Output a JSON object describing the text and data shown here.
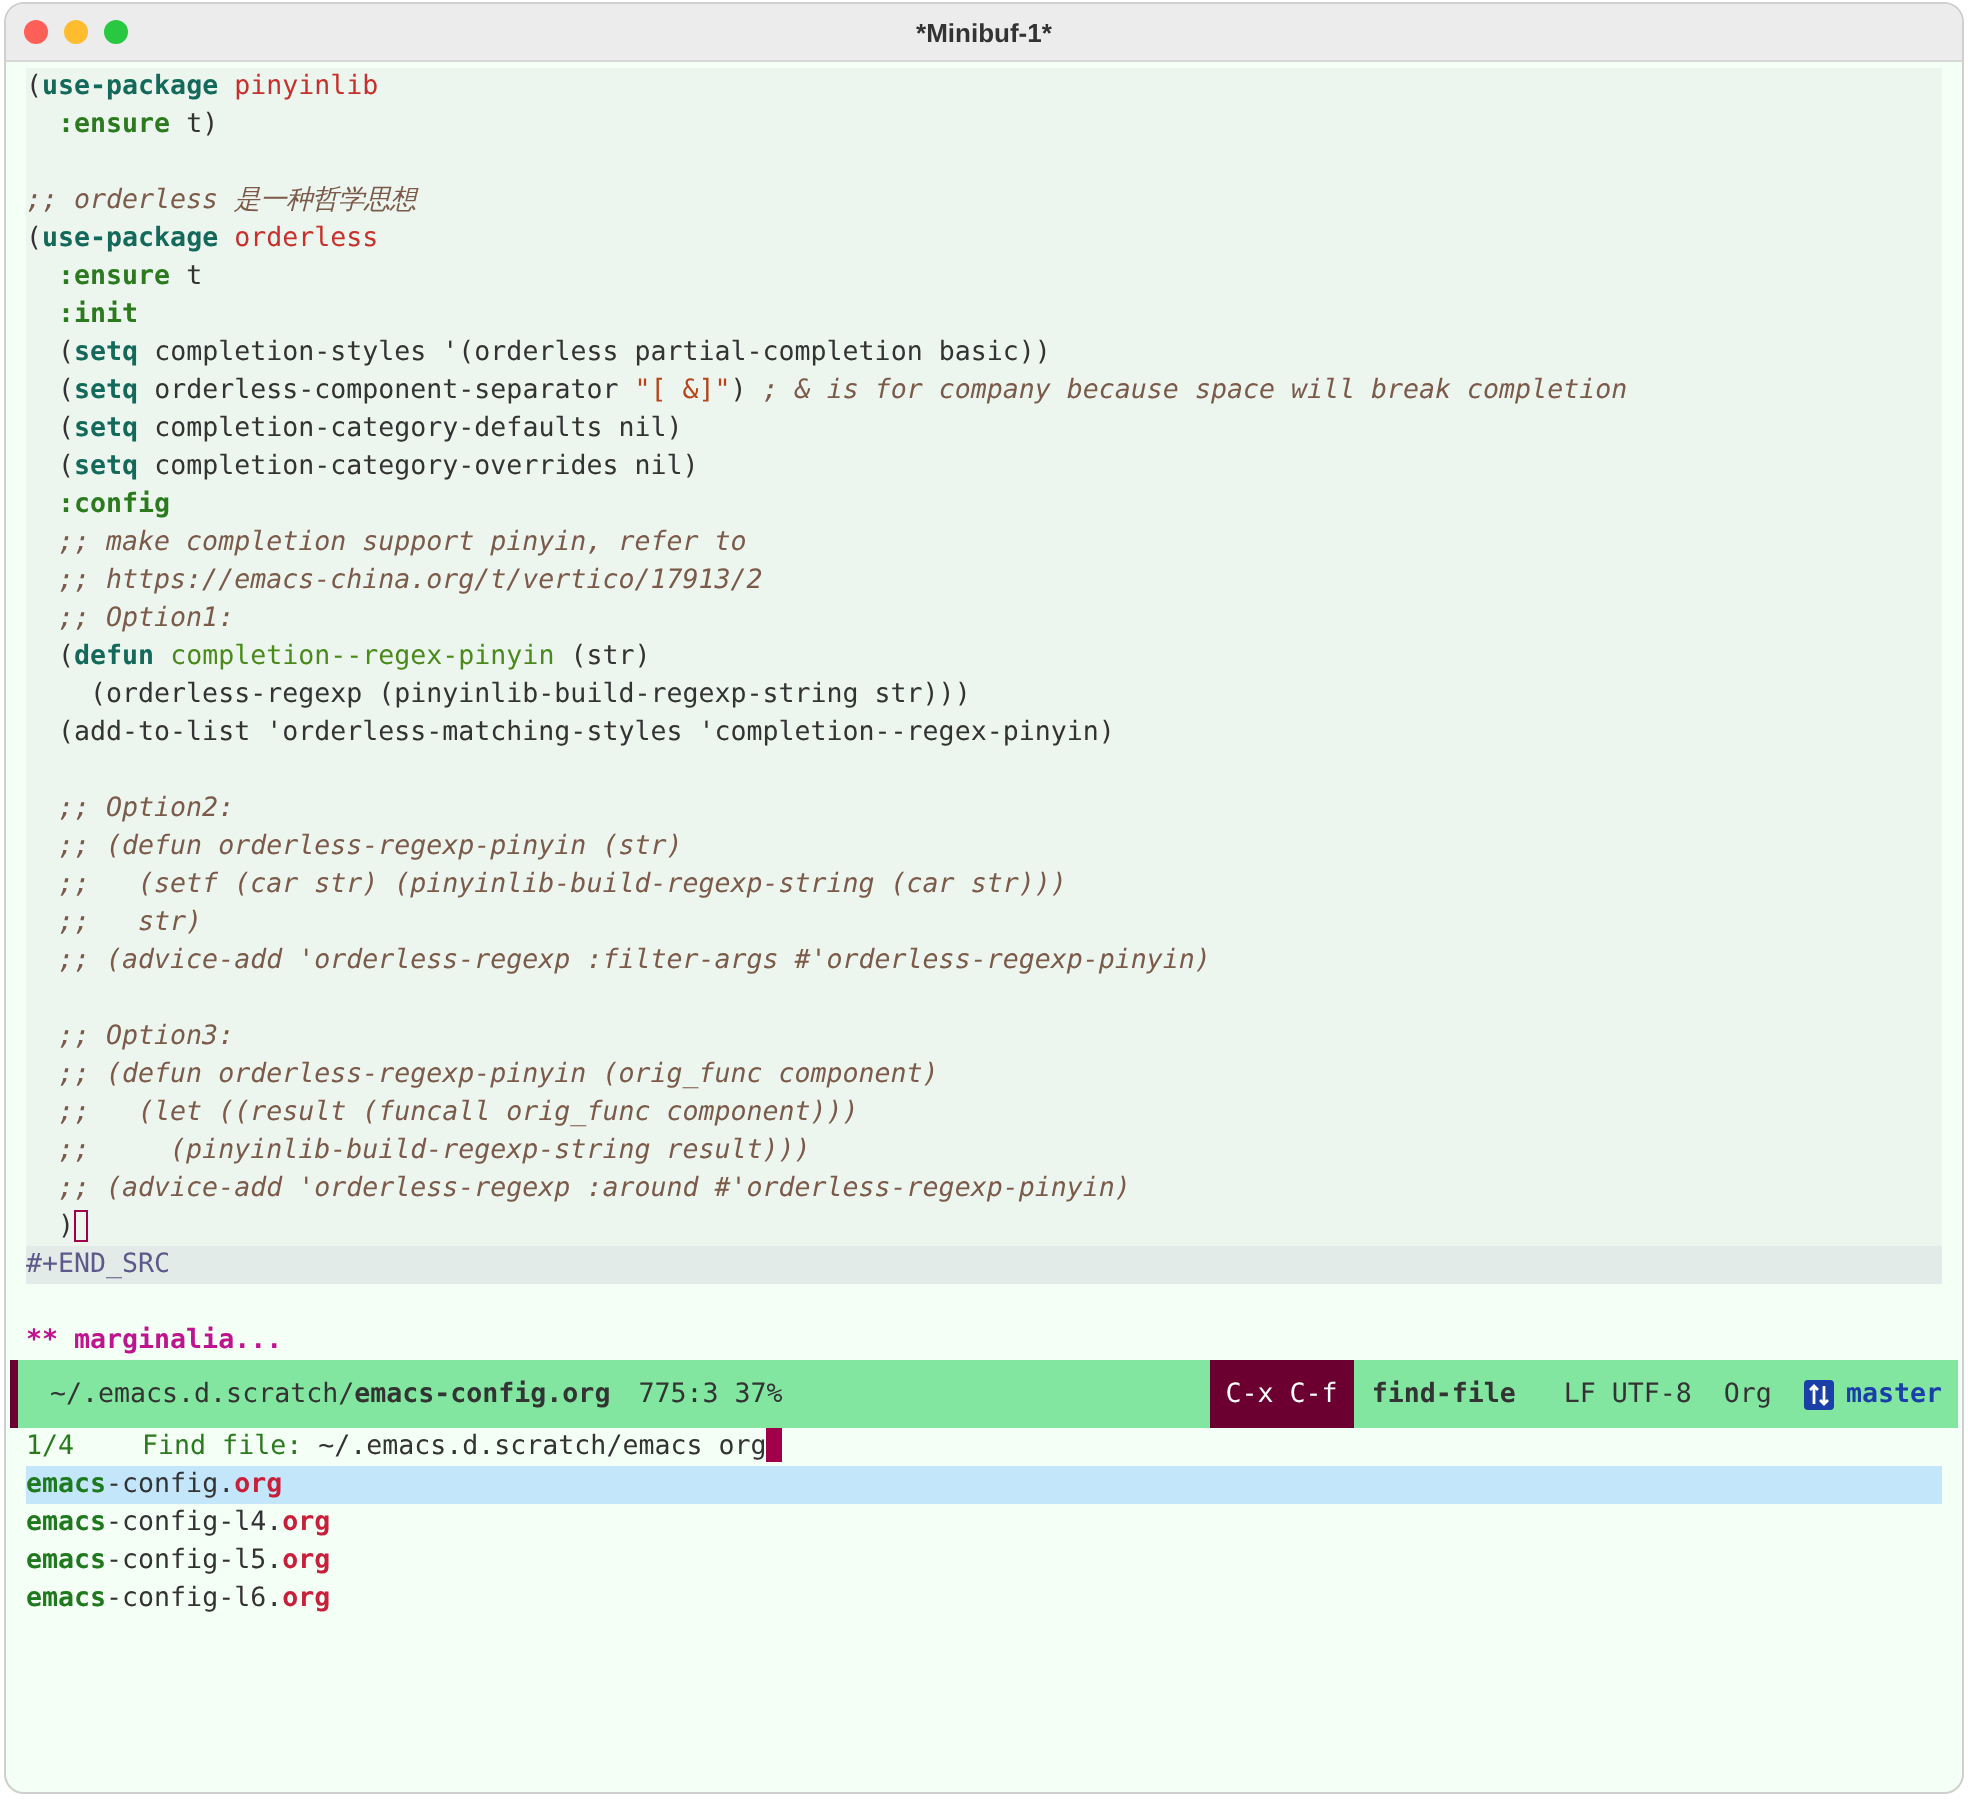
{
  "window": {
    "title": "*Minibuf-1*"
  },
  "code": {
    "lines": [
      {
        "kind": "code",
        "segments": [
          {
            "kind": "plain",
            "text": "("
          },
          {
            "kind": "kw",
            "text": "use-package"
          },
          {
            "kind": "pkg",
            "text": " pinyinlib"
          }
        ]
      },
      {
        "kind": "code",
        "segments": [
          {
            "kind": "prop",
            "text": "  :ensure"
          },
          {
            "kind": "plain",
            "text": " t)"
          }
        ]
      },
      {
        "kind": "blank"
      },
      {
        "kind": "code",
        "segments": [
          {
            "kind": "comment",
            "text": ";; orderless 是一种哲学思想"
          }
        ]
      },
      {
        "kind": "code",
        "segments": [
          {
            "kind": "plain",
            "text": "("
          },
          {
            "kind": "kw",
            "text": "use-package"
          },
          {
            "kind": "pkg",
            "text": " orderless"
          }
        ]
      },
      {
        "kind": "code",
        "segments": [
          {
            "kind": "prop",
            "text": "  :ensure"
          },
          {
            "kind": "plain",
            "text": " t"
          }
        ]
      },
      {
        "kind": "code",
        "segments": [
          {
            "kind": "prop",
            "text": "  :init"
          }
        ]
      },
      {
        "kind": "code",
        "segments": [
          {
            "kind": "plain",
            "text": "  ("
          },
          {
            "kind": "kw",
            "text": "setq"
          },
          {
            "kind": "plain",
            "text": " completion-styles '(orderless partial-completion basic))"
          }
        ]
      },
      {
        "kind": "code",
        "segments": [
          {
            "kind": "plain",
            "text": "  ("
          },
          {
            "kind": "kw",
            "text": "setq"
          },
          {
            "kind": "plain",
            "text": " orderless-component-separator "
          },
          {
            "kind": "string",
            "text": "\"[ &]\""
          },
          {
            "kind": "plain",
            "text": ")"
          },
          {
            "kind": "comment",
            "text": " ; & is for company because space will break completion"
          }
        ]
      },
      {
        "kind": "code",
        "segments": [
          {
            "kind": "plain",
            "text": "  ("
          },
          {
            "kind": "kw",
            "text": "setq"
          },
          {
            "kind": "plain",
            "text": " completion-category-defaults nil)"
          }
        ]
      },
      {
        "kind": "code",
        "segments": [
          {
            "kind": "plain",
            "text": "  ("
          },
          {
            "kind": "kw",
            "text": "setq"
          },
          {
            "kind": "plain",
            "text": " completion-category-overrides nil)"
          }
        ]
      },
      {
        "kind": "code",
        "segments": [
          {
            "kind": "prop",
            "text": "  :config"
          }
        ]
      },
      {
        "kind": "code",
        "segments": [
          {
            "kind": "comment",
            "text": "  ;; make completion support pinyin, refer to"
          }
        ]
      },
      {
        "kind": "code",
        "segments": [
          {
            "kind": "comment",
            "text": "  ;; https://emacs-china.org/t/vertico/17913/2"
          }
        ]
      },
      {
        "kind": "code",
        "segments": [
          {
            "kind": "comment",
            "text": "  ;; Option1:"
          }
        ]
      },
      {
        "kind": "code",
        "segments": [
          {
            "kind": "plain",
            "text": "  ("
          },
          {
            "kind": "kw",
            "text": "defun"
          },
          {
            "kind": "fn",
            "text": " completion--regex-pinyin"
          },
          {
            "kind": "plain",
            "text": " (str)"
          }
        ]
      },
      {
        "kind": "code",
        "segments": [
          {
            "kind": "plain",
            "text": "    (orderless-regexp (pinyinlib-build-regexp-string str)))"
          }
        ]
      },
      {
        "kind": "code",
        "segments": [
          {
            "kind": "plain",
            "text": "  (add-to-list 'orderless-matching-styles 'completion--regex-pinyin)"
          }
        ]
      },
      {
        "kind": "blank"
      },
      {
        "kind": "code",
        "segments": [
          {
            "kind": "comment",
            "text": "  ;; Option2:"
          }
        ]
      },
      {
        "kind": "code",
        "segments": [
          {
            "kind": "comment",
            "text": "  ;; (defun orderless-regexp-pinyin (str)"
          }
        ]
      },
      {
        "kind": "code",
        "segments": [
          {
            "kind": "comment",
            "text": "  ;;   (setf (car str) (pinyinlib-build-regexp-string (car str)))"
          }
        ]
      },
      {
        "kind": "code",
        "segments": [
          {
            "kind": "comment",
            "text": "  ;;   str)"
          }
        ]
      },
      {
        "kind": "code",
        "segments": [
          {
            "kind": "comment",
            "text": "  ;; (advice-add 'orderless-regexp :filter-args #'orderless-regexp-pinyin)"
          }
        ]
      },
      {
        "kind": "blank"
      },
      {
        "kind": "code",
        "segments": [
          {
            "kind": "comment",
            "text": "  ;; Option3:"
          }
        ]
      },
      {
        "kind": "code",
        "segments": [
          {
            "kind": "comment",
            "text": "  ;; (defun orderless-regexp-pinyin (orig_func component)"
          }
        ]
      },
      {
        "kind": "code",
        "segments": [
          {
            "kind": "comment",
            "text": "  ;;   (let ((result (funcall orig_func component)))"
          }
        ]
      },
      {
        "kind": "code",
        "segments": [
          {
            "kind": "comment",
            "text": "  ;;     (pinyinlib-build-regexp-string result)))"
          }
        ]
      },
      {
        "kind": "code",
        "segments": [
          {
            "kind": "comment",
            "text": "  ;; (advice-add 'orderless-regexp :around #'orderless-regexp-pinyin)"
          }
        ]
      },
      {
        "kind": "code",
        "segments": [
          {
            "kind": "plain",
            "text": "  )"
          },
          {
            "kind": "cursor"
          }
        ]
      }
    ],
    "end_marker": "#+END_SRC",
    "heading": "** marginalia..."
  },
  "mode_line": {
    "directory": "~/.emacs.d.scratch/",
    "file": "emacs-config.org",
    "position": "775:3 37%",
    "keys": "C-x C-f",
    "command": "find-file",
    "encoding": "LF UTF-8",
    "mode": "Org",
    "branch": "master"
  },
  "minibuffer": {
    "count": "1/4",
    "prompt": "Find file:",
    "input": "~/.emacs.d.scratch/emacs org",
    "candidates": [
      {
        "selected": true,
        "match": "emacs",
        "rest": "-config.",
        "ext": "org"
      },
      {
        "selected": false,
        "match": "emacs",
        "rest": "-config-l4.",
        "ext": "org"
      },
      {
        "selected": false,
        "match": "emacs",
        "rest": "-config-l5.",
        "ext": "org"
      },
      {
        "selected": false,
        "match": "emacs",
        "rest": "-config-l6.",
        "ext": "org"
      }
    ]
  }
}
